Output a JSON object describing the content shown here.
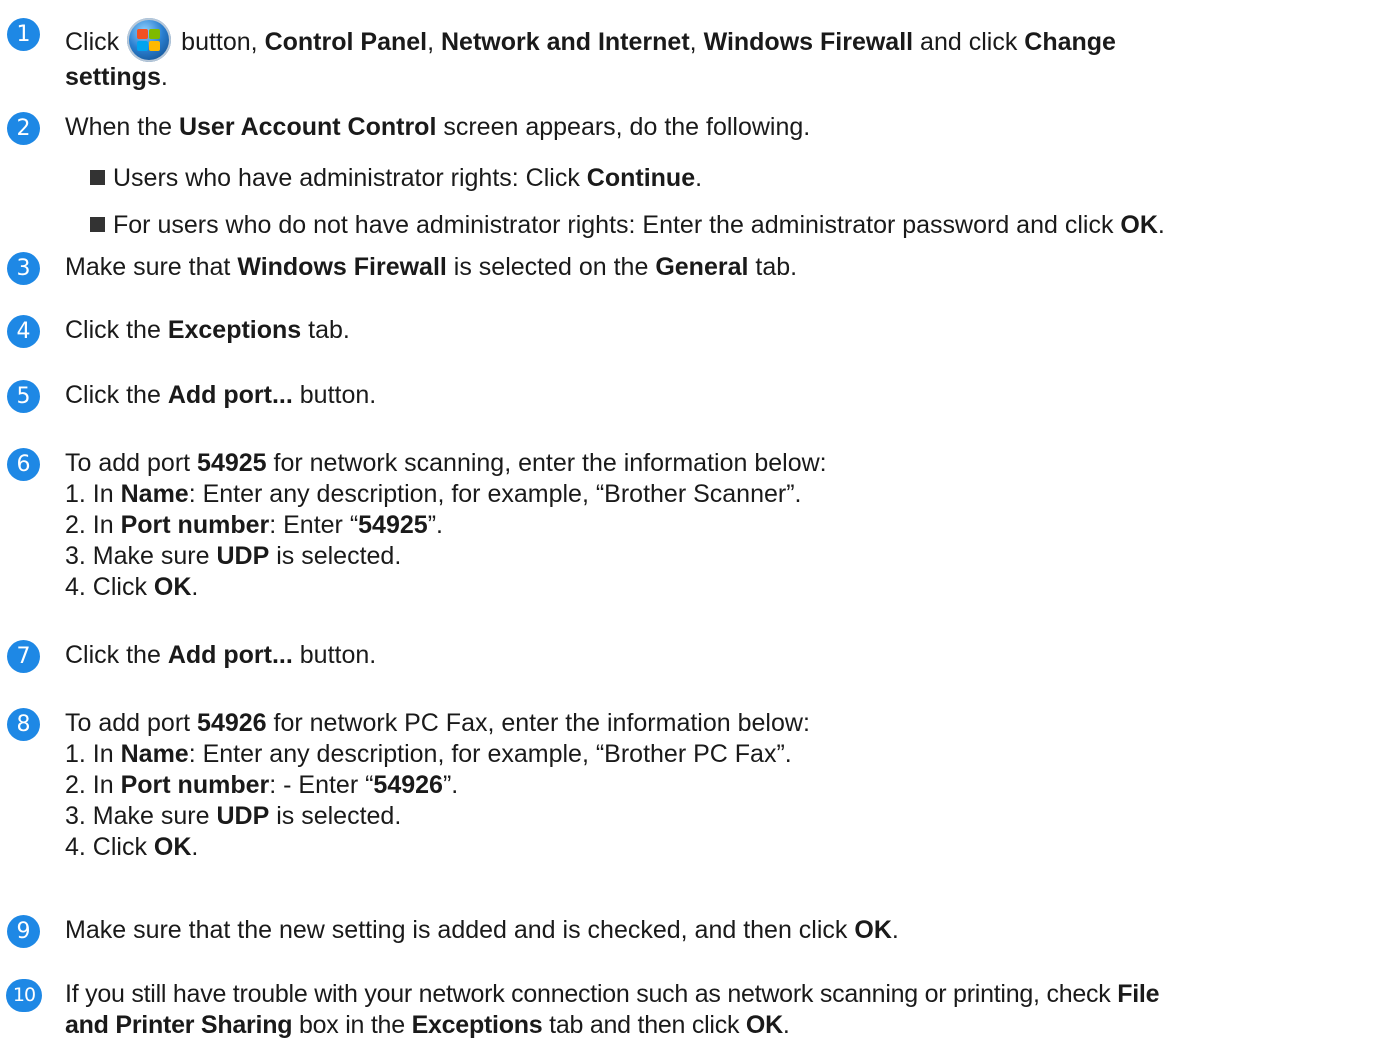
{
  "steps": [
    {
      "n": "1",
      "click": "Click",
      "rest": "button,",
      "cp": "Control Panel",
      "c1": ",",
      "ni": "Network and Internet",
      "c2": ",",
      "wf": "Windows Firewall",
      "and": "and click",
      "change": "Change",
      "settings": "settings",
      "dot": "."
    },
    {
      "n": "2",
      "a": "When the",
      "b": "User Account Control",
      "c": "screen appears, do the following.",
      "bullets": [
        {
          "a": "Users who have administrator rights: Click",
          "b": "Continue",
          "c": "."
        },
        {
          "a": "For users who do not have administrator rights: Enter the administrator password and click",
          "b": "OK",
          "c": "."
        }
      ]
    },
    {
      "n": "3",
      "a": "Make sure that",
      "b": "Windows Firewall",
      "c": "is selected on the",
      "d": "General",
      "e": "tab."
    },
    {
      "n": "4",
      "a": "Click the",
      "b": "Exceptions",
      "c": "tab."
    },
    {
      "n": "5",
      "a": "Click the",
      "b": "Add port...",
      "c": "button."
    },
    {
      "n": "6",
      "a": "To add port",
      "b": "54925",
      "c": "for network scanning, enter the information below:",
      "l1a": "1. In",
      "l1b": "Name",
      "l1c": ": Enter any description, for example, “Brother Scanner”.",
      "l2a": "2. In",
      "l2b": "Port number",
      "l2c": ": Enter “",
      "l2d": "54925",
      "l2e": "”.",
      "l3a": "3. Make sure",
      "l3b": "UDP",
      "l3c": "is selected.",
      "l4a": "4. Click",
      "l4b": "OK",
      "l4c": "."
    },
    {
      "n": "7",
      "a": "Click the",
      "b": "Add port...",
      "c": "button."
    },
    {
      "n": "8",
      "a": "To add port",
      "b": "54926",
      "c": "for network PC Fax, enter the information below:",
      "l1a": "1. In",
      "l1b": "Name",
      "l1c": ": Enter any description, for example, “Brother PC Fax”.",
      "l2a": "2. In",
      "l2b": "Port number",
      "l2c": ": - Enter “",
      "l2d": "54926",
      "l2e": "”.",
      "l3a": "3. Make sure",
      "l3b": "UDP",
      "l3c": "is selected.",
      "l4a": "4. Click",
      "l4b": "OK",
      "l4c": "."
    },
    {
      "n": "9",
      "a": "Make sure that the new setting is added and is checked, and then click",
      "b": "OK",
      "c": "."
    },
    {
      "n": "10",
      "a": "If you still have trouble with your network connection such as network scanning or printing, check",
      "b": "File",
      "b2": "and Printer Sharing",
      "c": "box in the",
      "d": "Exceptions",
      "e": "tab and then click",
      "f": "OK",
      "g": "."
    }
  ],
  "icons": {
    "start": "windows-start-orb-icon",
    "bullet": "square-bullet-icon",
    "badge_color": "#1e88e5"
  }
}
